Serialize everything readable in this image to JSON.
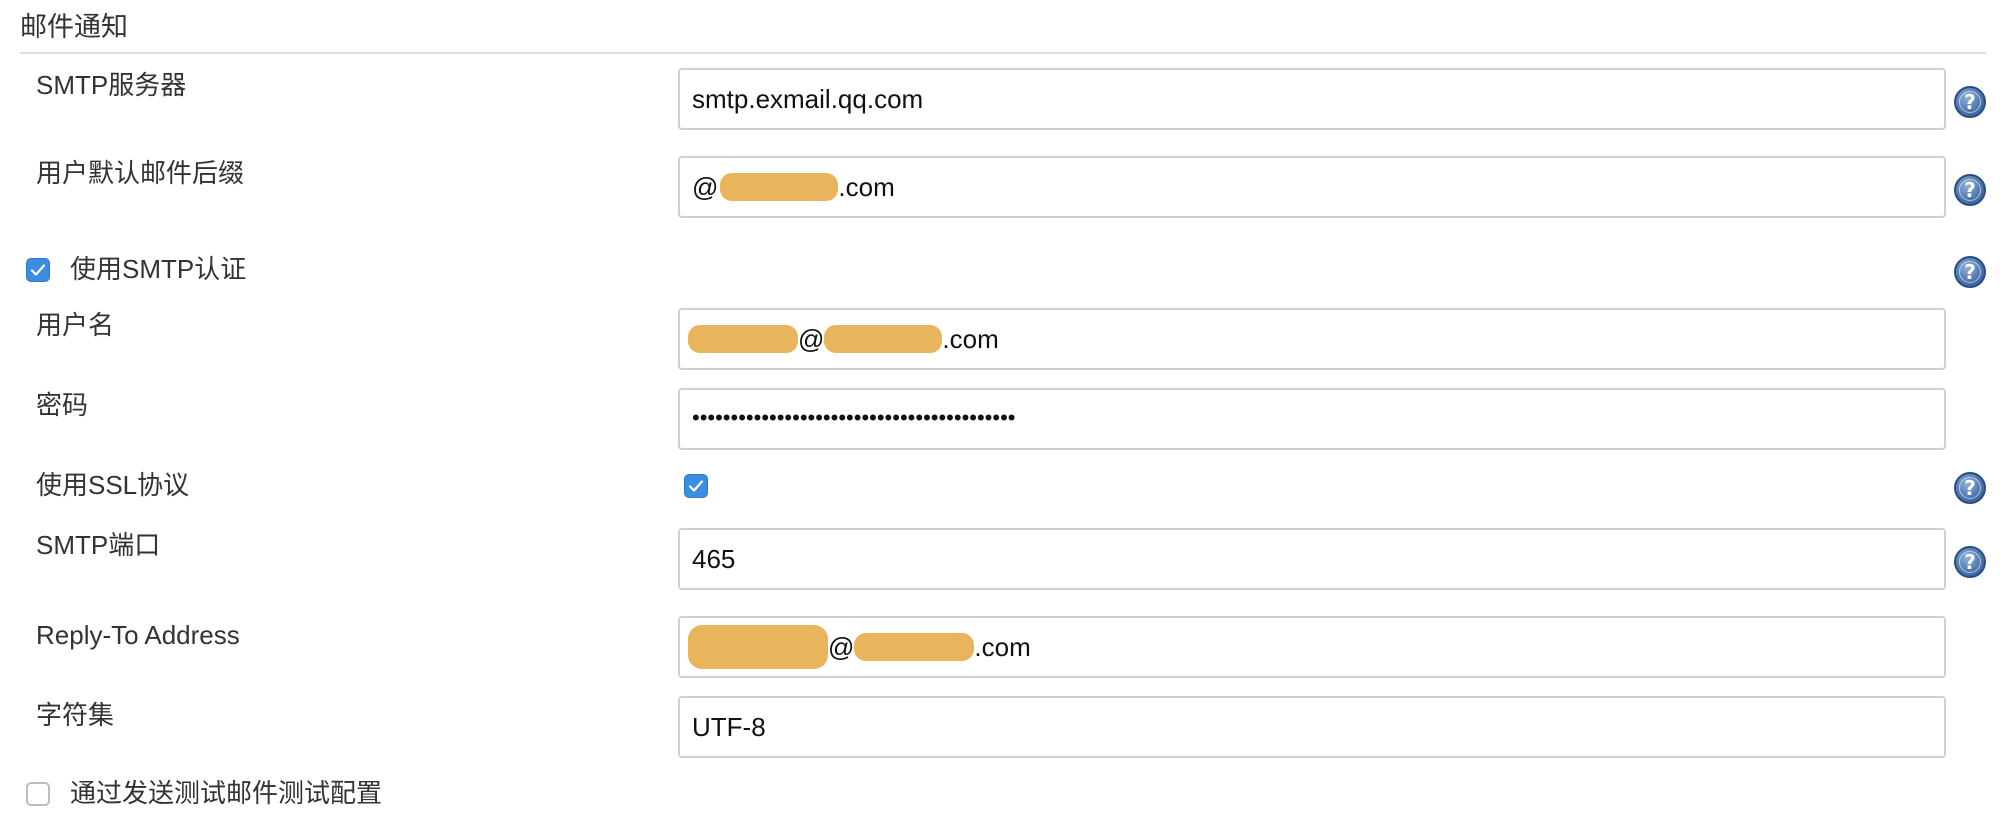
{
  "section": {
    "title": "邮件通知"
  },
  "fields": {
    "smtp_server": {
      "label": "SMTP服务器",
      "value": "smtp.exmail.qq.com"
    },
    "default_suffix": {
      "label": "用户默认邮件后缀",
      "prefix": "@",
      "suffix": ".com"
    },
    "use_smtp_auth": {
      "label": "使用SMTP认证",
      "checked": true
    },
    "username": {
      "label": "用户名",
      "middle": "@",
      "suffix": ".com"
    },
    "password": {
      "label": "密码",
      "masked": "••••••••••••••••••••••••••••••••••••••••••"
    },
    "use_ssl": {
      "label": "使用SSL协议",
      "checked": true
    },
    "smtp_port": {
      "label": "SMTP端口",
      "value": "465"
    },
    "reply_to": {
      "label": "Reply-To Address",
      "middle": "@",
      "suffix": ".com"
    },
    "charset": {
      "label": "字符集",
      "value": "UTF-8"
    },
    "test_config": {
      "label": "通过发送测试邮件测试配置",
      "checked": false
    }
  },
  "help_icon_glyph": "?",
  "colors": {
    "checkbox_checked": "#3b8de3",
    "redaction": "#e8b45c",
    "help_icon": "#4f77ad"
  }
}
